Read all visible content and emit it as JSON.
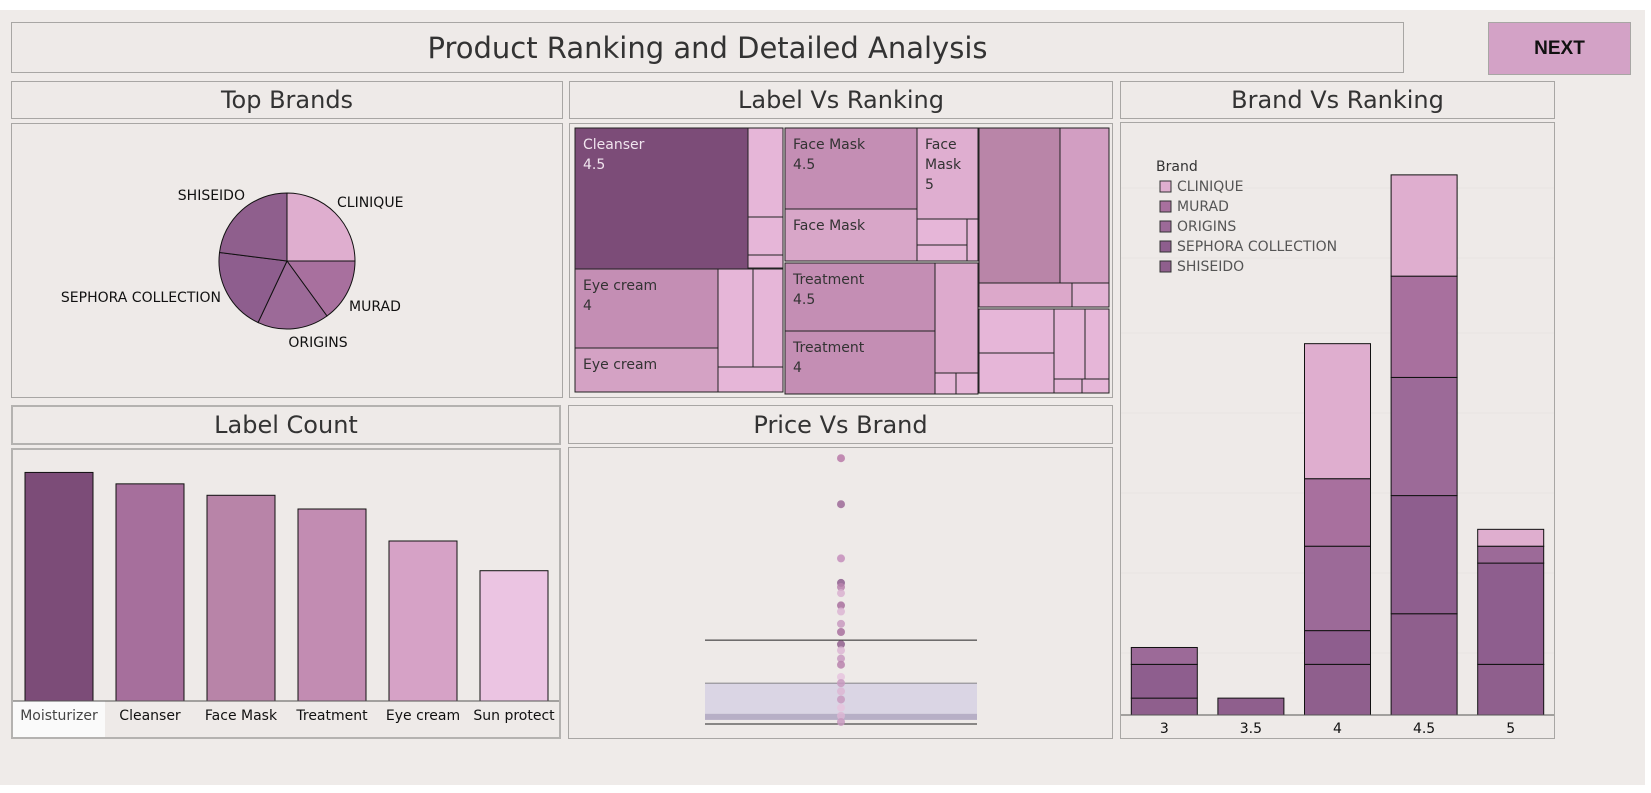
{
  "header": {
    "title": "Product Ranking and Detailed Analysis",
    "next_label": "NEXT"
  },
  "panels": {
    "top_brands": "Top Brands",
    "label_vs_ranking": "Label Vs Ranking",
    "brand_vs_ranking": "Brand Vs Ranking",
    "label_count": "Label Count",
    "price_vs_brand": "Price Vs Brand"
  },
  "pie": {
    "slices": [
      {
        "label": "CLINIQUE",
        "value": 25,
        "color": "#dfaecf"
      },
      {
        "label": "MURAD",
        "value": 15,
        "color": "#a8709e"
      },
      {
        "label": "ORIGINS",
        "value": 17,
        "color": "#9c6a98"
      },
      {
        "label": "SEPHORA COLLECTION",
        "value": 20,
        "color": "#8e5e8e"
      },
      {
        "label": "SHISEIDO",
        "value": 23,
        "color": "#8f5f8d"
      }
    ]
  },
  "treemap": {
    "cells": [
      {
        "label": "Cleanser",
        "value": "4.5",
        "color": "#7c4c78",
        "text_color": "#f0e4ee"
      },
      {
        "label": "Eye cream",
        "value": "4",
        "color": "#c48eb4",
        "text_color": "#333"
      },
      {
        "label": "Eye cream",
        "value": "",
        "color": "#d4a2c4",
        "text_color": "#333"
      },
      {
        "label": "Face Mask",
        "value": "4.5",
        "color": "#c48eb4",
        "text_color": "#333"
      },
      {
        "label": "Face Mask",
        "value": "5",
        "color": "#dfaed0",
        "text_color": "#333"
      },
      {
        "label": "Face Mask",
        "value": "",
        "color": "#d8a6c8",
        "text_color": "#333"
      },
      {
        "label": "Treatment",
        "value": "4.5",
        "color": "#c48eb4",
        "text_color": "#333"
      },
      {
        "label": "Treatment",
        "value": "4",
        "color": "#c48eb4",
        "text_color": "#333"
      }
    ]
  },
  "legend": {
    "title": "Brand",
    "items": [
      {
        "label": "CLINIQUE",
        "color": "#dfaecf"
      },
      {
        "label": "MURAD",
        "color": "#a8709e"
      },
      {
        "label": "ORIGINS",
        "color": "#9c6a98"
      },
      {
        "label": "SEPHORA COLLECTION",
        "color": "#8e5e8e"
      },
      {
        "label": "SHISEIDO",
        "color": "#8f5f8d"
      }
    ]
  },
  "chart_data": [
    {
      "type": "bar",
      "title": "Label Count",
      "categories": [
        "Moisturizer",
        "Cleanser",
        "Face Mask",
        "Treatment",
        "Eye cream",
        "Sun protect"
      ],
      "values": [
        100,
        95,
        90,
        84,
        70,
        57
      ],
      "colors": [
        "#7c4c78",
        "#a66f9c",
        "#b884a8",
        "#c28cb2",
        "#d6a2c6",
        "#ebc4e2"
      ],
      "xlabel": "",
      "ylabel": "",
      "ylim": [
        0,
        105
      ]
    },
    {
      "type": "bar",
      "title": "Brand Vs Ranking",
      "stacked": true,
      "categories": [
        "3",
        "3.5",
        "4",
        "4.5",
        "5"
      ],
      "ylim": [
        0,
        330
      ],
      "series": [
        {
          "name": "SHISEIDO",
          "color": "#8f5f8d",
          "values": [
            10,
            10,
            30,
            60,
            30
          ]
        },
        {
          "name": "SEPHORA COLLECTION",
          "color": "#8e5e8e",
          "values": [
            20,
            0,
            20,
            70,
            60
          ]
        },
        {
          "name": "ORIGINS",
          "color": "#9c6a98",
          "values": [
            10,
            0,
            50,
            70,
            10
          ]
        },
        {
          "name": "MURAD",
          "color": "#a8709e",
          "values": [
            0,
            0,
            40,
            60,
            0
          ]
        },
        {
          "name": "CLINIQUE",
          "color": "#dfaecf",
          "values": [
            0,
            0,
            80,
            60,
            10
          ]
        }
      ]
    },
    {
      "type": "scatter",
      "title": "Price Vs Brand",
      "ylim": [
        0,
        270
      ],
      "points": [
        {
          "y": 260,
          "color": "#b97aa8"
        },
        {
          "y": 215,
          "color": "#9c6a98"
        },
        {
          "y": 162,
          "color": "#c48ebb"
        },
        {
          "y": 138,
          "color": "#8e5e8e"
        },
        {
          "y": 134,
          "color": "#b883ad"
        },
        {
          "y": 128,
          "color": "#d9b2d0"
        },
        {
          "y": 116,
          "color": "#a8709e"
        },
        {
          "y": 110,
          "color": "#dcb6d4"
        },
        {
          "y": 98,
          "color": "#c89ac0"
        },
        {
          "y": 90,
          "color": "#a8709e"
        },
        {
          "y": 78,
          "color": "#8f5f8d"
        },
        {
          "y": 72,
          "color": "#dcb6d4"
        },
        {
          "y": 64,
          "color": "#c89ac0"
        },
        {
          "y": 58,
          "color": "#b883ad"
        },
        {
          "y": 46,
          "color": "#e6c4de"
        },
        {
          "y": 40,
          "color": "#c89ac0"
        },
        {
          "y": 32,
          "color": "#dcb6d4"
        },
        {
          "y": 24,
          "color": "#c89ac0"
        },
        {
          "y": 16,
          "color": "#e6c4de"
        },
        {
          "y": 8,
          "color": "#dcb6d4"
        },
        {
          "y": 2,
          "color": "#c89ac0"
        }
      ],
      "box": {
        "whisker_high": 82,
        "q3": 40,
        "median": 10,
        "q1": 4,
        "whisker_low": 0
      }
    }
  ]
}
